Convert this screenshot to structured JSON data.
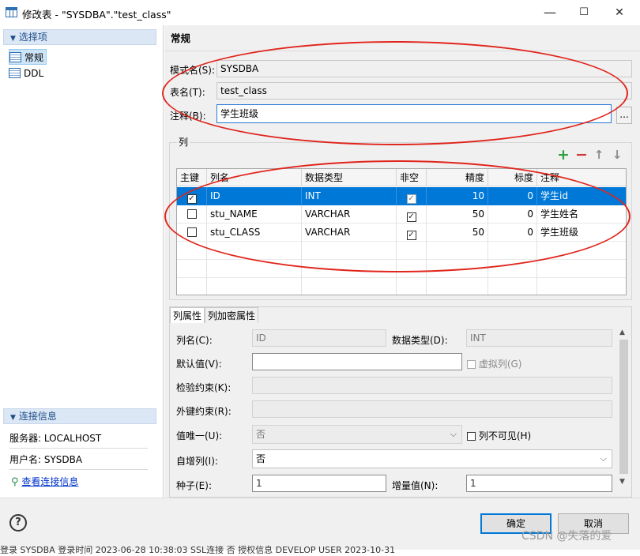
{
  "window": {
    "title": "修改表 - \"SYSDBA\".\"test_class\"",
    "min": "—",
    "max": "☐",
    "close": "✕"
  },
  "sidebar": {
    "section": "选择项",
    "items": [
      {
        "label": "常规"
      },
      {
        "label": "DDL"
      }
    ],
    "conn_section": "连接信息",
    "server": "服务器: LOCALHOST",
    "user": "用户名: SYSDBA",
    "view_conn": "查看连接信息"
  },
  "general": {
    "title": "常规",
    "schema_label": "模式名(S):",
    "schema_value": "SYSDBA",
    "table_label": "表名(T):",
    "table_value": "test_class",
    "comment_label": "注释(B):",
    "comment_value": "学生班级",
    "ellipsis": "..."
  },
  "columns": {
    "group_label": "列",
    "toolbar": {
      "add": "+",
      "remove": "−",
      "up": "↑",
      "down": "↓"
    },
    "headers": [
      "主键",
      "列名",
      "数据类型",
      "非空",
      "精度",
      "标度",
      "注释"
    ],
    "rows": [
      {
        "pk": "✓",
        "name": "ID",
        "type": "INT",
        "notnull": "✓",
        "precision": "10",
        "scale": "0",
        "comment": "学生id"
      },
      {
        "pk": "",
        "name": "stu_NAME",
        "type": "VARCHAR",
        "notnull": "✓",
        "precision": "50",
        "scale": "0",
        "comment": "学生姓名"
      },
      {
        "pk": "",
        "name": "stu_CLASS",
        "type": "VARCHAR",
        "notnull": "✓",
        "precision": "50",
        "scale": "0",
        "comment": "学生班级"
      }
    ]
  },
  "props": {
    "tab1": "列属性",
    "tab2": "列加密属性",
    "colname_label": "列名(C):",
    "colname_value": "ID",
    "datatype_label": "数据类型(D):",
    "datatype_value": "INT",
    "default_label": "默认值(V):",
    "default_value": "",
    "virtual_label": "虚拟列(G)",
    "check_label": "检验约束(K):",
    "fk_label": "外键约束(R):",
    "unique_label": "值唯一(U):",
    "unique_value": "否",
    "invisible_label": "列不可见(H)",
    "identity_label": "自增列(I):",
    "identity_value": "否",
    "seed_label": "种子(E):",
    "seed_value": "1",
    "inc_label": "增量值(N):",
    "inc_value": "1"
  },
  "footer": {
    "help": "?",
    "ok": "确定",
    "cancel": "取消",
    "status": "登录 SYSDBA    登录时间 2023-06-28 10:38:03    SSL连接 否    授权信息 DEVELOP USER    2023-10-31"
  },
  "watermark": "CSDN @失落的爱",
  "colors": {
    "accent": "#0078d7",
    "annotation": "#e0251c",
    "add": "#2ea043",
    "remove": "#d13438"
  }
}
